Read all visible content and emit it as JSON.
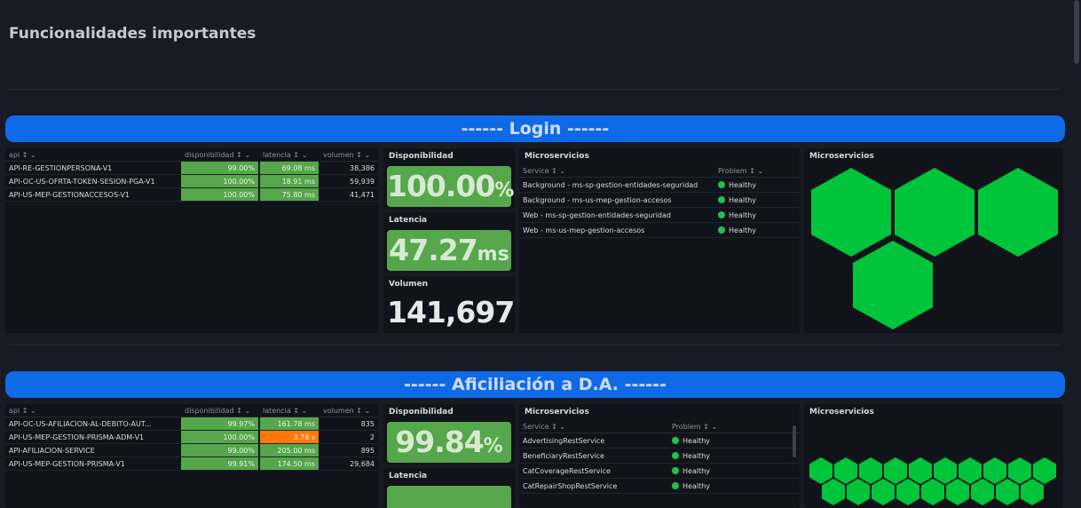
{
  "page_title": "Funcionalidades importantes",
  "sections": [
    {
      "banner": "------ Login ------",
      "table": {
        "headers": [
          "api ↕ ⌄",
          "disponibilidad ↕ ⌄",
          "latencia ↕ ⌄",
          "volumen ↕ ⌄"
        ],
        "rows": [
          {
            "api": "API-RE-GESTIONPERSONA-V1",
            "disp": "99.00%",
            "lat": "69.08 ms",
            "vol": "38,386",
            "lat_state": "ok"
          },
          {
            "api": "API-OC-US-OFRTA-TOKEN-SESION-PGA-V1",
            "disp": "100.00%",
            "lat": "18.91 ms",
            "vol": "59,939",
            "lat_state": "ok"
          },
          {
            "api": "API-US-MEP-GESTIONACCESOS-V1",
            "disp": "100.00%",
            "lat": "75.80 ms",
            "vol": "41,471",
            "lat_state": "ok"
          }
        ]
      },
      "stats": {
        "disponibilidad_title": "Disponibilidad",
        "disponibilidad_value": "100.00",
        "disponibilidad_unit": "%",
        "latencia_title": "Latencia",
        "latencia_value": "47.27",
        "latencia_unit": "ms",
        "volumen_title": "Volumen",
        "volumen_value": "141,697"
      },
      "services": {
        "title": "Microservicios",
        "headers": [
          "Service ↕ ⌄",
          "Problem ↕ ⌄"
        ],
        "rows": [
          {
            "service": "Background - ms-sp-gestion-entidades-seguridad",
            "status": "Healthy"
          },
          {
            "service": "Background - ms-us-mep-gestion-accesos",
            "status": "Healthy"
          },
          {
            "service": "Web - ms-sp-gestion-entidades-seguridad",
            "status": "Healthy"
          },
          {
            "service": "Web - ms-us-mep-gestion-accesos",
            "status": "Healthy"
          }
        ]
      },
      "honeycomb": {
        "title": "Microservicios",
        "count": 4,
        "color": "#00c53b"
      }
    },
    {
      "banner": "------ Aficiliación a D.A. ------",
      "table": {
        "headers": [
          "api ↕ ⌄",
          "disponibilidad ↕ ⌄",
          "latencia ↕ ⌄",
          "volumen ↕ ⌄"
        ],
        "rows": [
          {
            "api": "API-OC-US-AFILIACION-AL-DEBITO-AUT...",
            "disp": "99.97%",
            "lat": "161.78 ms",
            "vol": "835",
            "lat_state": "ok"
          },
          {
            "api": "API-US-MEP-GESTION-PRISMA-ADM-V1",
            "disp": "100.00%",
            "lat": "3.78 s",
            "vol": "2",
            "lat_state": "warn"
          },
          {
            "api": "API-AFILIACION-SERVICE",
            "disp": "99.00%",
            "lat": "205.00 ms",
            "vol": "895",
            "lat_state": "ok"
          },
          {
            "api": "API-US-MEP-GESTION-PRISMA-V1",
            "disp": "99.91%",
            "lat": "174.50 ms",
            "vol": "29,684",
            "lat_state": "ok"
          }
        ]
      },
      "stats": {
        "disponibilidad_title": "Disponibilidad",
        "disponibilidad_value": "99.84",
        "disponibilidad_unit": "%",
        "latencia_title": "Latencia"
      },
      "services": {
        "title": "Microservicios",
        "headers": [
          "Service ↕ ⌄",
          "Problem ↕ ⌄"
        ],
        "rows": [
          {
            "service": "AdvertisingRestService",
            "status": "Healthy"
          },
          {
            "service": "BeneficiaryRestService",
            "status": "Healthy"
          },
          {
            "service": "CatCoverageRestService",
            "status": "Healthy"
          },
          {
            "service": "CatRepairShopRestService",
            "status": "Healthy"
          }
        ]
      },
      "honeycomb": {
        "title": "Microservicios",
        "count": 19,
        "color": "#00c53b"
      }
    }
  ]
}
